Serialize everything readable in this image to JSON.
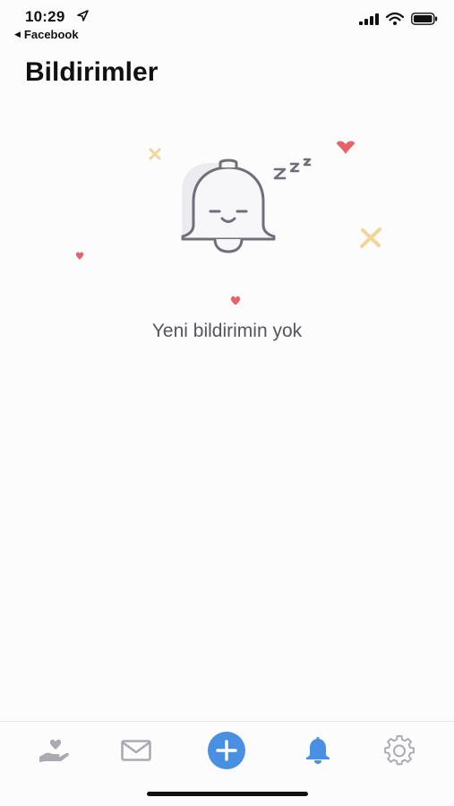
{
  "status_bar": {
    "time": "10:29",
    "back_app": "Facebook",
    "icons": [
      "location-arrow-icon",
      "signal-icon",
      "wifi-icon",
      "battery-icon"
    ]
  },
  "page": {
    "title": "Bildirimler"
  },
  "empty_state": {
    "message": "Yeni bildirimin yok",
    "illustration": "sleeping-bell-icon",
    "snore_text": "z z z"
  },
  "tab_bar": {
    "items": [
      {
        "icon": "heart-hand-icon",
        "active": false
      },
      {
        "icon": "mail-icon",
        "active": false
      },
      {
        "icon": "add-icon",
        "active": false
      },
      {
        "icon": "bell-icon",
        "active": true
      },
      {
        "icon": "gear-icon",
        "active": false
      }
    ]
  },
  "colors": {
    "accent": "#4a90e2",
    "inactive_icon": "#a9abb0",
    "heart": "#e7636a",
    "sparkle": "#f2d59a",
    "bell_stroke": "#6f6f7a"
  }
}
